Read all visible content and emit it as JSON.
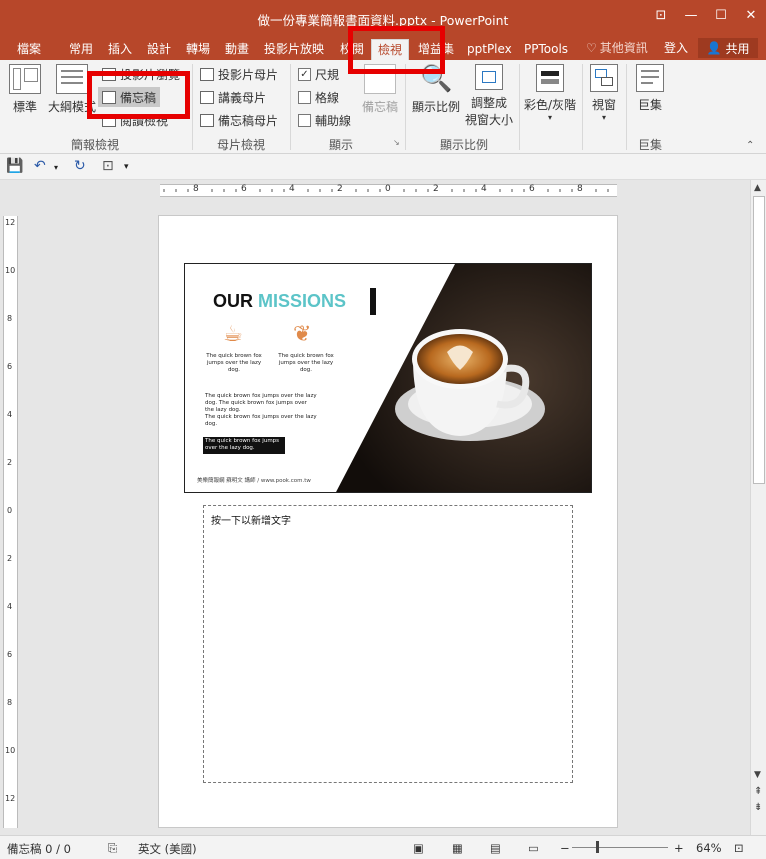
{
  "window": {
    "title": "做一份專業簡報書面資料.pptx - PowerPoint",
    "controls": [
      "ribbon-display",
      "minimize",
      "maximize",
      "close"
    ]
  },
  "tabs": [
    {
      "label": "檔案"
    },
    {
      "label": "常用"
    },
    {
      "label": "插入"
    },
    {
      "label": "設計"
    },
    {
      "label": "轉場"
    },
    {
      "label": "動畫"
    },
    {
      "label": "投影片放映"
    },
    {
      "label": "校閱"
    },
    {
      "label": "檢視",
      "active": true
    },
    {
      "label": "增益集"
    },
    {
      "label": "pptPlex"
    },
    {
      "label": "PPTools"
    }
  ],
  "tell_me": "其他資訊",
  "login": "登入",
  "share": "共用",
  "ribbon": {
    "presentation_views": {
      "label": "簡報檢視",
      "normal": "標準",
      "outline": "大綱模式",
      "slide_sorter": "投影片瀏覽",
      "notes_page": "備忘稿",
      "reading_view": "閱讀檢視"
    },
    "master_views": {
      "label": "母片檢視",
      "slide_master": "投影片母片",
      "handout_master": "講義母片",
      "notes_master": "備忘稿母片"
    },
    "show": {
      "label": "顯示",
      "ruler": "尺規",
      "gridlines": "格線",
      "guides": "輔助線",
      "notes": "備忘稿",
      "ruler_checked": true
    },
    "zoom": {
      "label": "顯示比例",
      "zoom": "顯示比例",
      "fit_line1": "調整成",
      "fit_line2": "視窗大小"
    },
    "color": {
      "color_grayscale": "彩色/灰階"
    },
    "window": {
      "window": "視窗"
    },
    "macros": {
      "label": "巨集",
      "macros": "巨集"
    }
  },
  "rulers": {
    "h_labels": [
      "8",
      "6",
      "4",
      "2",
      "0",
      "2",
      "4",
      "6",
      "8"
    ],
    "v_labels": [
      "12",
      "10",
      "8",
      "6",
      "4",
      "2",
      "0",
      "2",
      "4",
      "6",
      "8",
      "10",
      "12"
    ]
  },
  "slide": {
    "title_dark": "OUR ",
    "title_accent": "MISSIONS",
    "feature1": "The quick brown fox jumps over the lazy dog.",
    "feature2": "The quick brown fox jumps over the lazy dog.",
    "body1": "The quick brown fox jumps over the lazy dog. The quick brown fox jumps over the lazy dog.",
    "body2": "The quick brown fox jumps over the lazy dog.",
    "box_text": "The quick brown fox jumps over the lazy dog.",
    "footer": "美樂簡報網 蘇明文 講師 / www.pook.com.tw"
  },
  "notes": {
    "placeholder": "按一下以新增文字"
  },
  "status": {
    "page": "備忘稿 0 / 0",
    "language": "英文 (美國)",
    "zoom": "64%"
  },
  "colors": {
    "accent": "#b7472a",
    "highlight": "#e60000",
    "title_accent": "#5cc4c8"
  }
}
